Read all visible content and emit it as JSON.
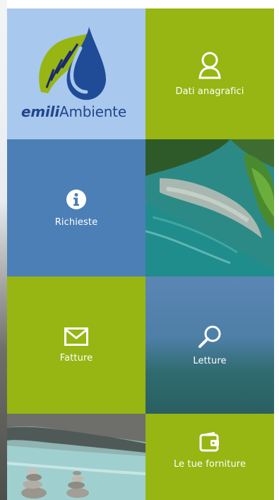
{
  "logo": {
    "brand_bold": "emili",
    "brand_regular": "Ambiente",
    "colors": {
      "blue": "#1f4b97",
      "green": "#97b513"
    }
  },
  "tiles": [
    {
      "label": "Dati anagrafici",
      "icon": "user-icon",
      "color": "#97b513"
    },
    {
      "label": "Richieste",
      "icon": "info-icon",
      "color": "#4c7fb5"
    },
    {
      "label": "Fatture",
      "icon": "envelope-icon",
      "color": "#97b513"
    },
    {
      "label": "Letture",
      "icon": "magnifier-icon",
      "color": "#4e7fa6"
    },
    {
      "label": "Le tue forniture",
      "icon": "wallet-icon",
      "color": "#97b513"
    }
  ]
}
